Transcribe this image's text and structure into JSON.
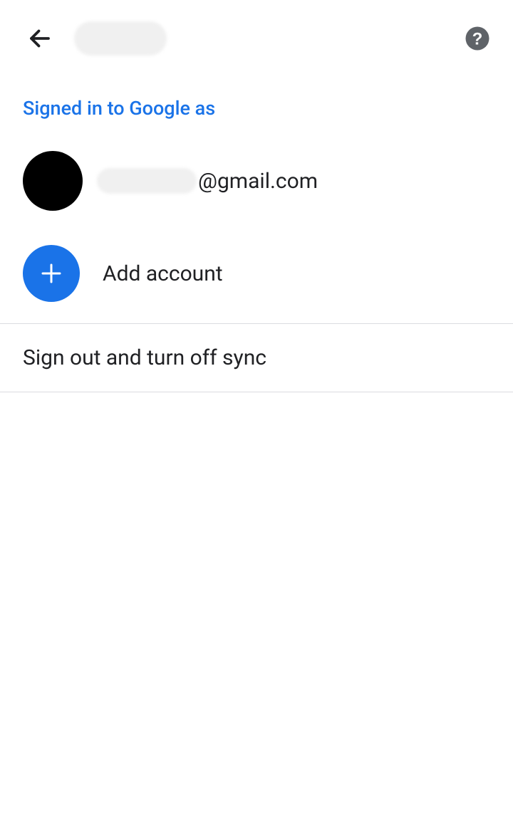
{
  "header": {
    "back_icon": "back-arrow",
    "help_icon": "help"
  },
  "section": {
    "heading": "Signed in to Google as"
  },
  "account": {
    "email_suffix": "@gmail.com"
  },
  "add_account": {
    "label": "Add account"
  },
  "sign_out": {
    "label": "Sign out and turn off sync"
  },
  "colors": {
    "accent": "#1a73e8"
  }
}
